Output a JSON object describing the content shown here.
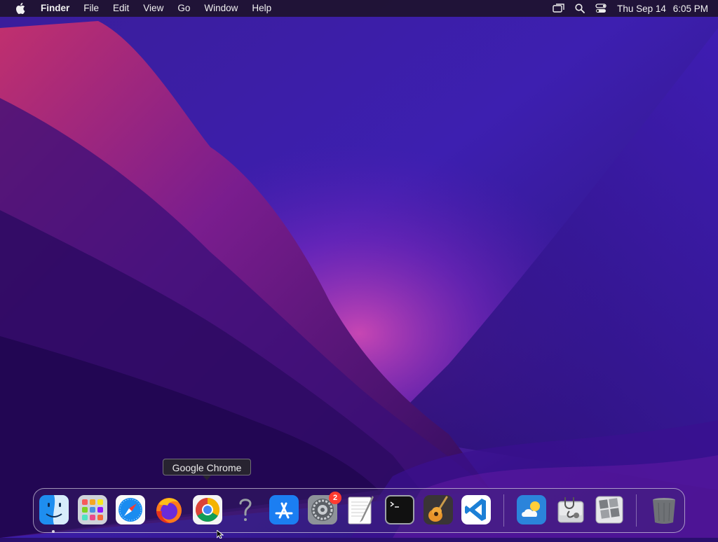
{
  "menubar": {
    "apple_icon": "apple-logo-icon",
    "app_name": "Finder",
    "menus": [
      "File",
      "Edit",
      "View",
      "Go",
      "Window",
      "Help"
    ],
    "status_icons": [
      "screen-mirroring-icon",
      "spotlight-search-icon",
      "control-center-icon"
    ],
    "clock": {
      "day_date": "Thu Sep 14",
      "time": "6:05 PM"
    }
  },
  "tooltip": {
    "label": "Google Chrome"
  },
  "dock": {
    "apps": [
      {
        "name": "Finder",
        "icon": "finder-icon",
        "running": true
      },
      {
        "name": "Launchpad",
        "icon": "launchpad-icon"
      },
      {
        "name": "Safari",
        "icon": "safari-icon"
      },
      {
        "name": "Firefox",
        "icon": "firefox-icon"
      },
      {
        "name": "Google Chrome",
        "icon": "chrome-icon"
      },
      {
        "name": "Unknown",
        "icon": "question-mark-icon"
      },
      {
        "name": "App Store",
        "icon": "app-store-icon"
      },
      {
        "name": "System Preferences",
        "icon": "system-preferences-icon",
        "badge": "2"
      },
      {
        "name": "TextEdit",
        "icon": "textedit-icon"
      },
      {
        "name": "Terminal",
        "icon": "terminal-icon"
      },
      {
        "name": "GarageBand",
        "icon": "garageband-icon"
      },
      {
        "name": "Visual Studio Code",
        "icon": "vscode-icon"
      },
      {
        "name": "Weather",
        "icon": "weather-icon"
      },
      {
        "name": "Disk Utility",
        "icon": "disk-utility-icon"
      },
      {
        "name": "Boot Camp Assistant",
        "icon": "boot-camp-icon"
      },
      {
        "name": "Trash",
        "icon": "trash-icon"
      }
    ]
  },
  "colors": {
    "wallpaper_base": "#2a0f6e",
    "wallpaper_magenta": "#b01e8a",
    "badge_red": "#ff3b30"
  }
}
